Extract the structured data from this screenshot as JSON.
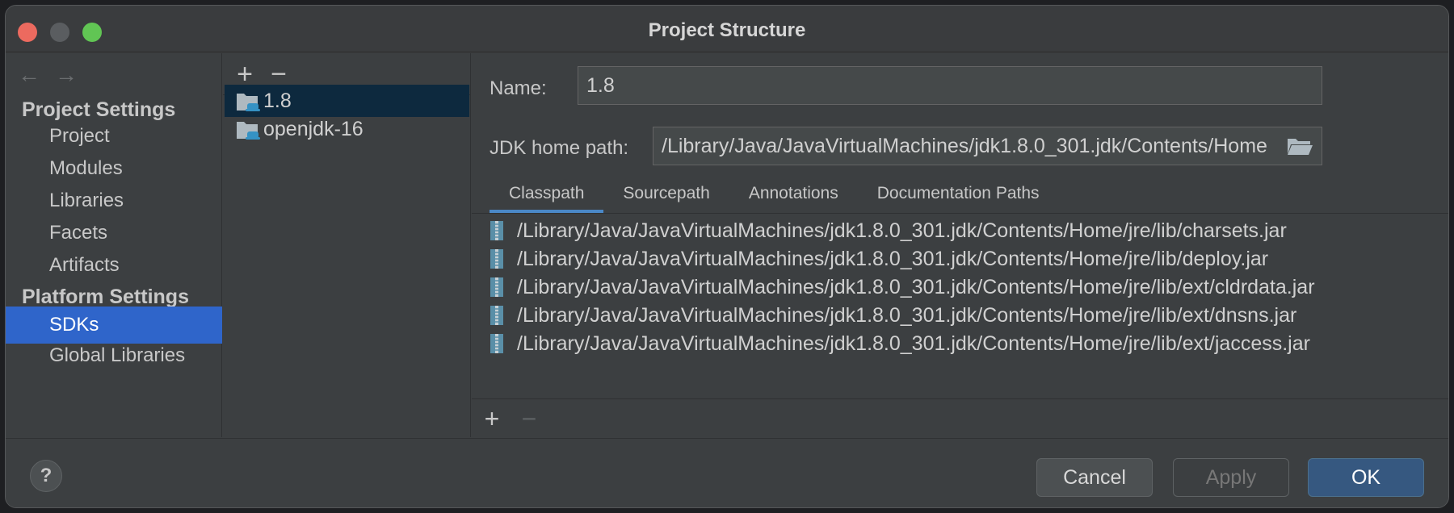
{
  "window": {
    "title": "Project Structure"
  },
  "nav": {
    "back_arrow": "←",
    "forward_arrow": "→",
    "project_settings_title": "Project Settings",
    "project_items": [
      "Project",
      "Modules",
      "Libraries",
      "Facets",
      "Artifacts"
    ],
    "platform_settings_title": "Platform Settings",
    "platform_items": [
      "SDKs",
      "Global Libraries"
    ],
    "selected": "SDKs"
  },
  "sdk_panel": {
    "add_label": "+",
    "remove_label": "−",
    "items": [
      "1.8",
      "openjdk-16"
    ],
    "selected": "1.8"
  },
  "form": {
    "name_label": "Name:",
    "name_value": "1.8",
    "jdk_home_label": "JDK home path:",
    "jdk_home_value": "/Library/Java/JavaVirtualMachines/jdk1.8.0_301.jdk/Contents/Home",
    "tabs": [
      "Classpath",
      "Sourcepath",
      "Annotations",
      "Documentation Paths"
    ],
    "active_tab": "Classpath",
    "classpath": [
      "/Library/Java/JavaVirtualMachines/jdk1.8.0_301.jdk/Contents/Home/jre/lib/charsets.jar",
      "/Library/Java/JavaVirtualMachines/jdk1.8.0_301.jdk/Contents/Home/jre/lib/deploy.jar",
      "/Library/Java/JavaVirtualMachines/jdk1.8.0_301.jdk/Contents/Home/jre/lib/ext/cldrdata.jar",
      "/Library/Java/JavaVirtualMachines/jdk1.8.0_301.jdk/Contents/Home/jre/lib/ext/dnsns.jar",
      "/Library/Java/JavaVirtualMachines/jdk1.8.0_301.jdk/Contents/Home/jre/lib/ext/jaccess.jar"
    ],
    "cp_add_label": "+",
    "cp_remove_label": "−"
  },
  "footer": {
    "help_label": "?",
    "cancel_label": "Cancel",
    "apply_label": "Apply",
    "ok_label": "OK"
  },
  "colors": {
    "selection_nav": "#2f65ca",
    "selection_list": "#0d293e",
    "tab_underline": "#4a88c7",
    "primary_button": "#365880",
    "folder_icon": "#aeb9c0",
    "jdk_badge": "#3592c4"
  },
  "icons": {
    "sdk": "jdk-folder-icon",
    "jar": "jar-archive-icon",
    "browse": "folder-open-icon"
  }
}
